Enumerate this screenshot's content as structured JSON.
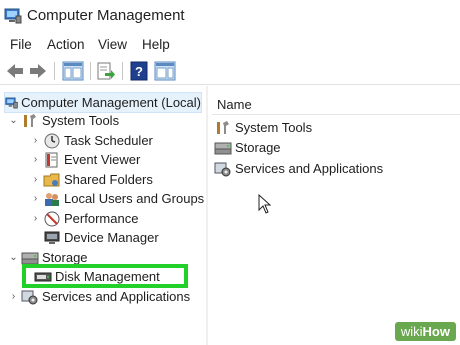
{
  "window": {
    "title": "Computer Management"
  },
  "menu": {
    "items": [
      "File",
      "Action",
      "View",
      "Help"
    ]
  },
  "toolbar": {
    "buttons": [
      "back-arrow-icon",
      "forward-arrow-icon",
      "show-hide-console-tree-icon",
      "export-list-icon",
      "help-icon",
      "show-action-pane-icon"
    ]
  },
  "tree": {
    "root": "Computer Management (Local)",
    "system_tools": "System Tools",
    "task_scheduler": "Task Scheduler",
    "event_viewer": "Event Viewer",
    "shared_folders": "Shared Folders",
    "local_users": "Local Users and Groups",
    "performance": "Performance",
    "device_manager": "Device Manager",
    "storage": "Storage",
    "disk_management": "Disk Management",
    "services_apps": "Services and Applications"
  },
  "list": {
    "header_name": "Name",
    "items": [
      "System Tools",
      "Storage",
      "Services and Applications"
    ]
  },
  "colors": {
    "highlight": "#22d02a",
    "selection": "#e5f1fb",
    "watermark": "#6aa84f"
  },
  "watermark": {
    "wiki": "wiki",
    "how": "How"
  }
}
